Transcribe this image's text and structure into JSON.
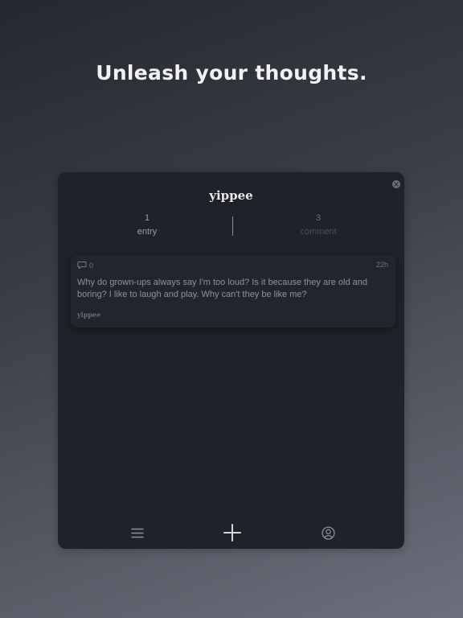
{
  "headline": "Unleash your thoughts.",
  "app": {
    "title": "yippee",
    "stats": {
      "entry_count": "1",
      "entry_label": "entry",
      "comment_count": "3",
      "comment_label": "comment"
    },
    "posts": [
      {
        "comment_count": "0",
        "time": "22h",
        "text": "Why do grown-ups always say I'm too loud? Is it because they are old and boring? I like to laugh and play. Why can't they be like me?",
        "author": "yippee"
      }
    ],
    "tabbar": {
      "icons": [
        "menu-icon",
        "plus-icon",
        "profile-icon"
      ]
    }
  },
  "colors": {
    "background_top": "#25282e",
    "background_bottom": "#6c707c",
    "app_background": "#1f2228",
    "card_background": "#22252b",
    "text_primary": "#e7e7ea",
    "text_secondary": "#8f9299"
  }
}
